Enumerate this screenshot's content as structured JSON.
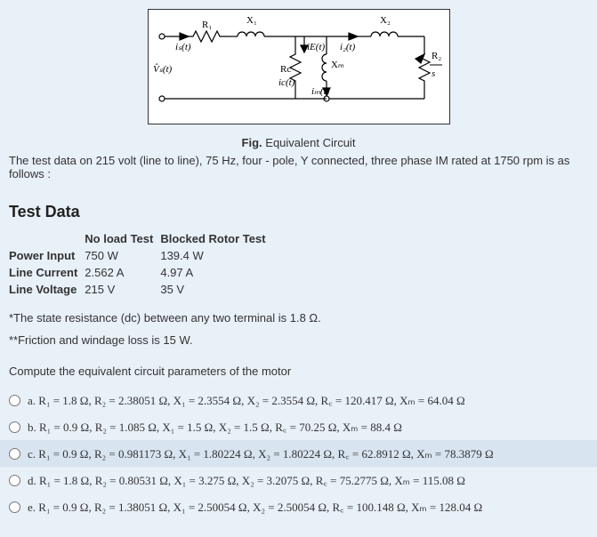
{
  "circuit": {
    "labels": {
      "Vs": "V̂ₛ(t)",
      "is": "iₛ(t)",
      "R1": "R₁",
      "X1": "X₁",
      "Rc": "Rc",
      "ic": "ic(t)",
      "Xm": "Xₘ",
      "im": "iₘ(t)",
      "iE": "iE(t)",
      "X2": "X₂",
      "i2": "i₂(t)",
      "R2": "R₂",
      "s": "s"
    }
  },
  "figCaption": {
    "bold": "Fig.",
    "text": " Equivalent Circuit"
  },
  "introText": "The test data on 215 volt (line to line), 75 Hz, four - pole, Y connected, three phase IM rated at 1750 rpm is as follows :",
  "sectionTitle": "Test Data",
  "table": {
    "headers": [
      "",
      "No load Test",
      "Blocked Rotor Test"
    ],
    "rows": [
      {
        "label": "Power Input",
        "col1": "750 W",
        "col2": "139.4 W"
      },
      {
        "label": "Line Current",
        "col1": "2.562 A",
        "col2": "4.97 A"
      },
      {
        "label": "Line Voltage",
        "col1": "215 V",
        "col2": "35 V"
      }
    ]
  },
  "note1": "*The state resistance (dc) between any two terminal is 1.8 Ω.",
  "note2": "**Friction and windage loss is 15 W.",
  "computeText": "Compute the equivalent circuit parameters of the motor",
  "options": [
    {
      "key": "a",
      "text": "R₁ = 1.8 Ω,  R₂ = 2.38051 Ω,  X₁ = 2.3554 Ω,  X₂ = 2.3554 Ω,  R꜀ = 120.417 Ω,  Xₘ = 64.04 Ω"
    },
    {
      "key": "b",
      "text": "R₁ = 0.9 Ω,  R₂ = 1.085 Ω,  X₁ = 1.5 Ω,  X₂ = 1.5 Ω,  R꜀ = 70.25 Ω,  Xₘ = 88.4 Ω"
    },
    {
      "key": "c",
      "text": "R₁ = 0.9 Ω,  R₂ = 0.981173 Ω,  X₁ = 1.80224 Ω,  X₂ = 1.80224 Ω,  R꜀ = 62.8912 Ω,  Xₘ = 78.3879 Ω"
    },
    {
      "key": "d",
      "text": "R₁ = 1.8 Ω,  R₂ = 0.80531 Ω,  X₁ = 3.275 Ω,  X₂ = 3.2075 Ω,  R꜀ = 75.2775 Ω,  Xₘ = 115.08 Ω"
    },
    {
      "key": "e",
      "text": "R₁ = 0.9 Ω,  R₂ = 1.38051 Ω,  X₁ = 2.50054 Ω,  X₂ = 2.50054 Ω,  R꜀ = 100.148 Ω,  Xₘ = 128.04 Ω"
    }
  ],
  "highlightedOption": 2
}
